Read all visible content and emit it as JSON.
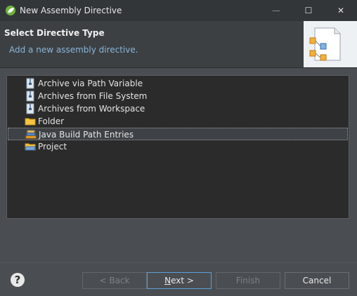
{
  "window": {
    "title": "New Assembly Directive",
    "controls": {
      "minimize": "—",
      "maximize": "☐",
      "close": "✕"
    }
  },
  "header": {
    "title": "Select Directive Type",
    "description": "Add a new assembly directive."
  },
  "tree": {
    "items": [
      {
        "label": "Archive via Path Variable",
        "icon": "archive-icon",
        "selected": false
      },
      {
        "label": "Archives from File System",
        "icon": "archive-icon",
        "selected": false
      },
      {
        "label": "Archives from Workspace",
        "icon": "archive-icon",
        "selected": false
      },
      {
        "label": "Folder",
        "icon": "folder-icon",
        "selected": false
      },
      {
        "label": "Java Build Path Entries",
        "icon": "library-icon",
        "selected": true
      },
      {
        "label": "Project",
        "icon": "project-icon",
        "selected": false
      }
    ]
  },
  "footer": {
    "help_icon": "?",
    "back_label": "< Back",
    "next_mnemonic": "N",
    "next_rest": "ext >",
    "finish_label": "Finish",
    "cancel_label": "Cancel"
  },
  "colors": {
    "accent": "#5aa0d8",
    "description_text": "#8ab4d8",
    "background": "#4a4e52"
  }
}
